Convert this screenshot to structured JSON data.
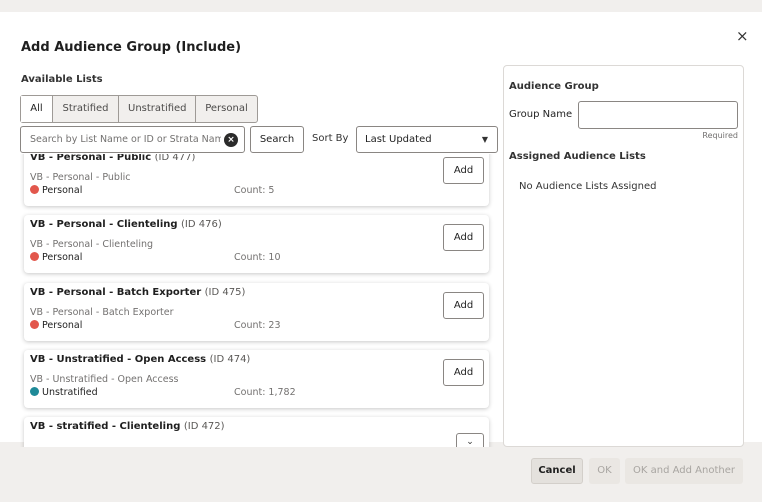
{
  "dialog": {
    "title": "Add Audience Group (Include)",
    "close_glyph": "×"
  },
  "available": {
    "label": "Available Lists",
    "tabs": [
      {
        "label": "All",
        "active": true
      },
      {
        "label": "Stratified",
        "active": false
      },
      {
        "label": "Unstratified",
        "active": false
      },
      {
        "label": "Personal",
        "active": false
      }
    ],
    "search": {
      "placeholder": "Search by List Name or ID or Strata Nam",
      "value": "",
      "button_label": "Search"
    },
    "sort": {
      "label": "Sort By",
      "selected": "Last Updated"
    },
    "items": [
      {
        "name": "VB - Personal - Public",
        "id": "(ID 477)",
        "subtitle": "VB - Personal - Public",
        "type": "Personal",
        "count": "Count: 5",
        "action": "Add"
      },
      {
        "name": "VB - Personal - Clienteling",
        "id": "(ID 476)",
        "subtitle": "VB - Personal - Clienteling",
        "type": "Personal",
        "count": "Count: 10",
        "action": "Add"
      },
      {
        "name": "VB - Personal - Batch Exporter",
        "id": "(ID 475)",
        "subtitle": "VB - Personal - Batch Exporter",
        "type": "Personal",
        "count": "Count: 23",
        "action": "Add"
      },
      {
        "name": "VB - Unstratified - Open Access",
        "id": "(ID 474)",
        "subtitle": "VB - Unstratified - Open Access",
        "type": "Unstratified",
        "count": "Count: 1,782",
        "action": "Add"
      },
      {
        "name": "VB - stratified - Clienteling",
        "id": "(ID 472)"
      }
    ]
  },
  "colors": {
    "personal": "#e2574c",
    "unstratified": "#1f8a98"
  },
  "audience_group": {
    "heading": "Audience Group",
    "group_name_label": "Group Name",
    "group_name_value": "",
    "required_text": "Required",
    "assigned_heading": "Assigned Audience Lists",
    "empty_text": "No Audience Lists Assigned"
  },
  "footer": {
    "cancel_label": "Cancel",
    "ok_label": "OK",
    "ok_another_label": "OK and Add Another"
  }
}
